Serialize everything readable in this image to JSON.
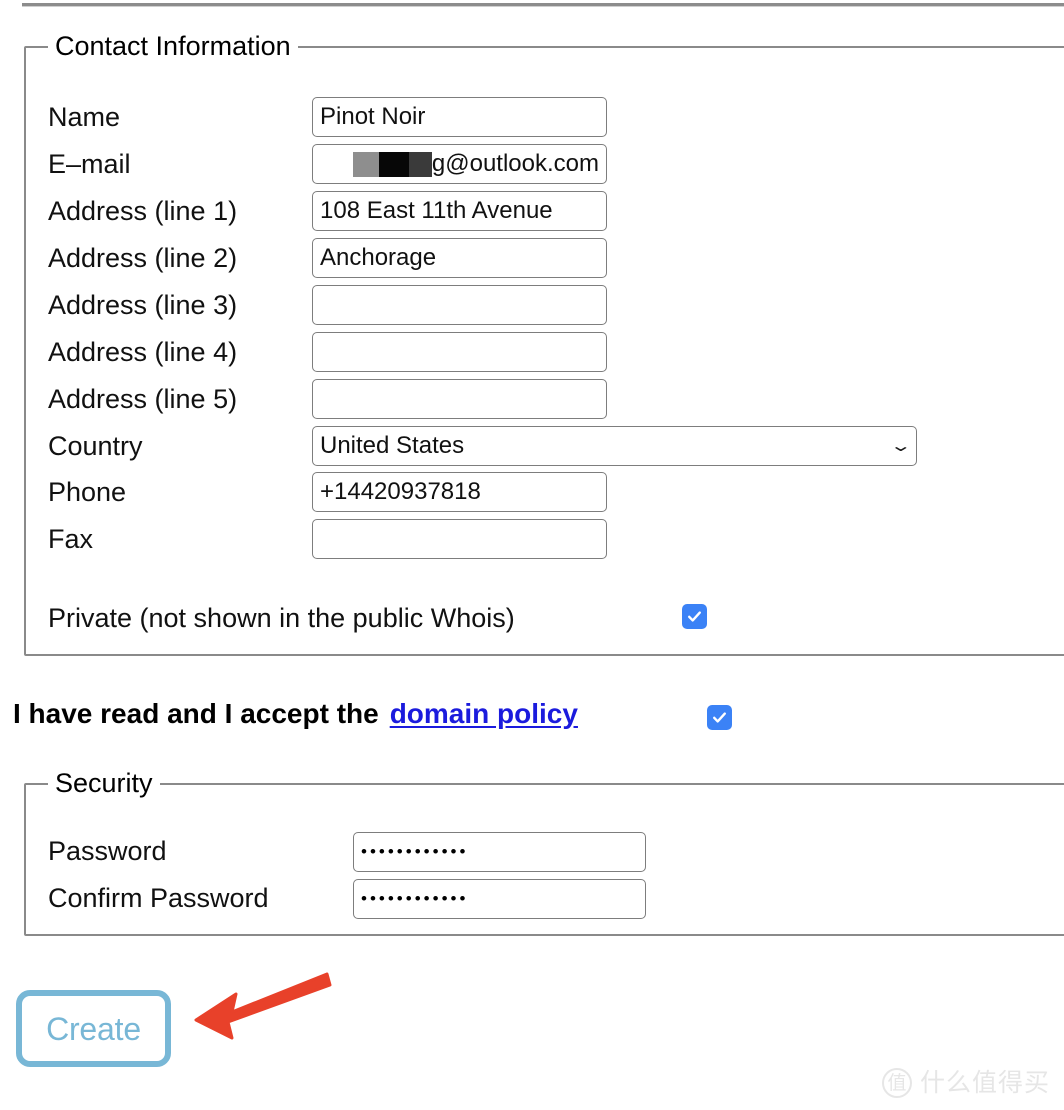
{
  "page": {
    "background": "#ffffff",
    "accent_blue": "#3b82f6",
    "link_blue": "#1b1bdd",
    "button_blue": "#78b7d6",
    "arrow_red": "#e8412a"
  },
  "contact": {
    "legend": "Contact Information",
    "fields": [
      {
        "label": "Name",
        "value": "Pinot Noir",
        "placeholder": "",
        "type": "text"
      },
      {
        "label": "E–mail",
        "value": "g@outlook.com",
        "placeholder": "",
        "type": "email-redacted"
      },
      {
        "label": "Address (line 1)",
        "value": "108 East 11th Avenue",
        "placeholder": "",
        "type": "text"
      },
      {
        "label": "Address (line 2)",
        "value": "Anchorage",
        "placeholder": "",
        "type": "text"
      },
      {
        "label": "Address (line 3)",
        "value": "",
        "placeholder": "",
        "type": "text"
      },
      {
        "label": "Address (line 4)",
        "value": "",
        "placeholder": "",
        "type": "text"
      },
      {
        "label": "Address (line 5)",
        "value": "",
        "placeholder": "",
        "type": "text"
      },
      {
        "label": "Country",
        "value": "United States",
        "placeholder": "",
        "type": "select"
      },
      {
        "label": "Phone",
        "value": "+14420937818",
        "placeholder": "",
        "type": "text"
      },
      {
        "label": "Fax",
        "value": "",
        "placeholder": "",
        "type": "text"
      }
    ],
    "private_checkbox": {
      "label": "Private (not shown in the public Whois)",
      "checked": true
    }
  },
  "policy": {
    "text": "I have read and I accept the",
    "link_label": "domain policy",
    "trailing": ".",
    "checked": true
  },
  "security": {
    "legend": "Security",
    "fields": [
      {
        "label": "Password",
        "value": "••••••••••••",
        "placeholder": "",
        "type": "password"
      },
      {
        "label": "Confirm Password",
        "value": "••••••••••••",
        "placeholder": "",
        "type": "password"
      }
    ]
  },
  "actions": {
    "create_label": "Create"
  },
  "annotation": {
    "arrow": "arrow-pointing-left-to-create-button"
  },
  "watermark": {
    "badge": "值",
    "text": "什么值得买"
  }
}
